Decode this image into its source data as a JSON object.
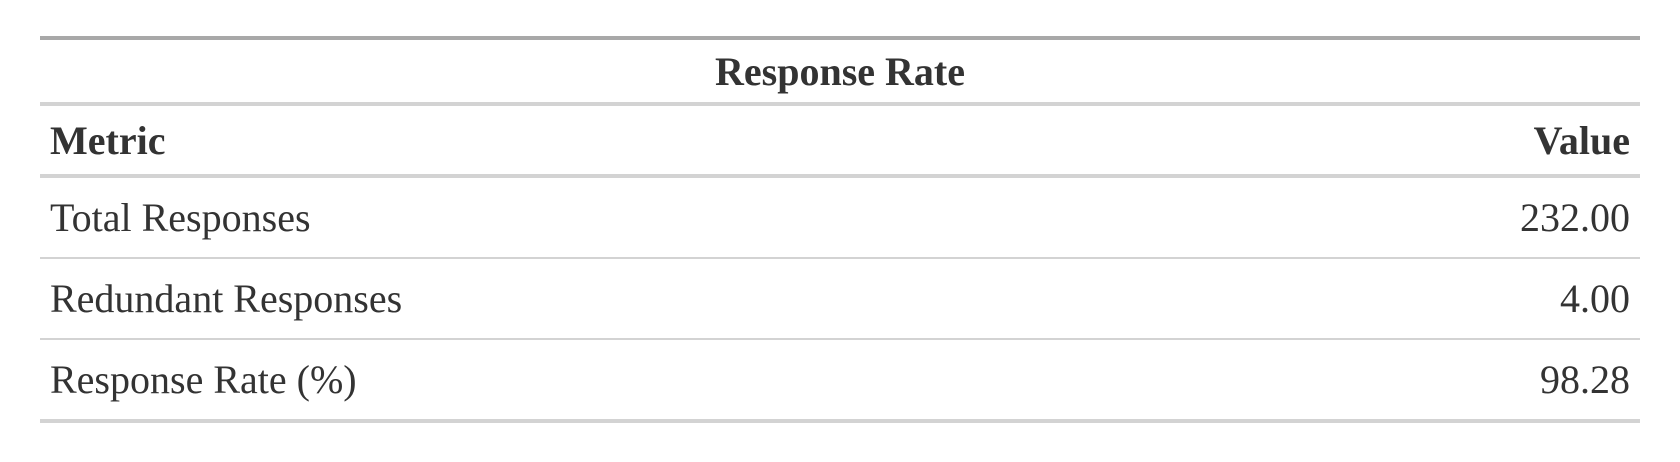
{
  "table": {
    "title": "Response Rate",
    "columns": [
      "Metric",
      "Value"
    ],
    "rows": [
      {
        "metric": "Total Responses",
        "value": "232.00"
      },
      {
        "metric": "Redundant Responses",
        "value": "4.00"
      },
      {
        "metric": "Response Rate (%)",
        "value": "98.28"
      }
    ]
  }
}
